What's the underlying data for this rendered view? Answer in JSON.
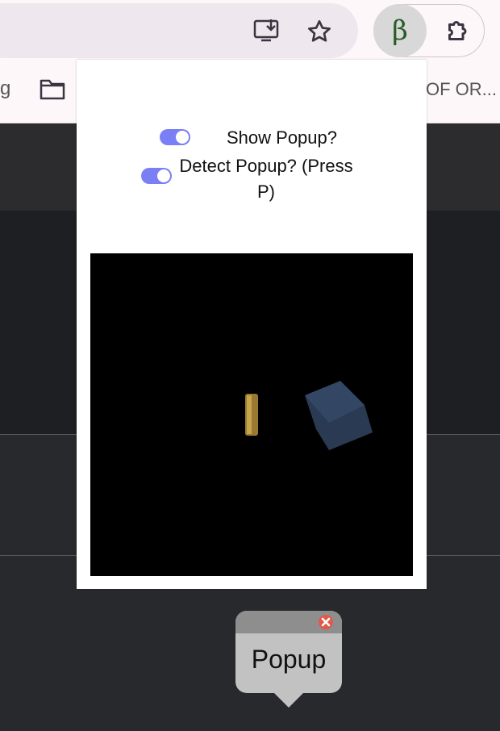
{
  "browser": {
    "bookmarks": {
      "left_truncated_text": "g",
      "right_truncated_text": "OF OR..."
    },
    "icons": {
      "install": "install-app-icon",
      "star": "star-icon",
      "extension": "beta-extension-icon",
      "extension_glyph": "β",
      "extensions_menu": "puzzle-icon",
      "folder": "folder-icon"
    }
  },
  "extension_popup": {
    "show_popup_label": "Show Popup?",
    "show_popup_enabled": true,
    "detect_popup_label": "Detect Popup? (Press P)",
    "detect_popup_enabled": true,
    "accent_color": "#7b7ff5"
  },
  "page_popup": {
    "text": "Popup",
    "close_icon": "close-icon",
    "close_color": "#e05a4a"
  }
}
